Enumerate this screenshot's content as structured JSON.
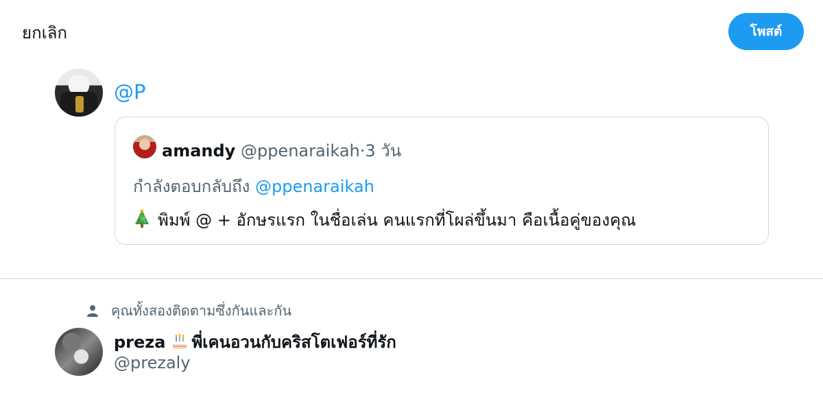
{
  "header": {
    "cancel_label": "ยกเลิก",
    "post_label": "โพสต์"
  },
  "compose": {
    "text": "@P"
  },
  "quoted_tweet": {
    "name": "amandy",
    "handle": "@ppenaraikah",
    "separator": "·",
    "time": "3 วัน",
    "reply_prefix": "กำลังตอบกลับถึง",
    "reply_to": "@ppenaraikah",
    "emoji_icon": "christmas-tree-icon",
    "body": "พิมพ์ @ + อักษรแรก ในชื่อเล่น คนแรกที่โผล่ขึ้นมา คือเนื้อคู่ของคุณ"
  },
  "suggestion": {
    "context": "คุณทั้งสองติดตามซึ่งกันและกัน",
    "name": "preza",
    "emoji_icon": "birthday-cake-icon",
    "name_suffix": "พี่เคนอวนกับคริสโตเฟอร์ที่รัก",
    "handle": "@prezaly"
  },
  "colors": {
    "accent": "#1d9bf0",
    "muted_text": "#536471",
    "border": "#cfd9de"
  }
}
